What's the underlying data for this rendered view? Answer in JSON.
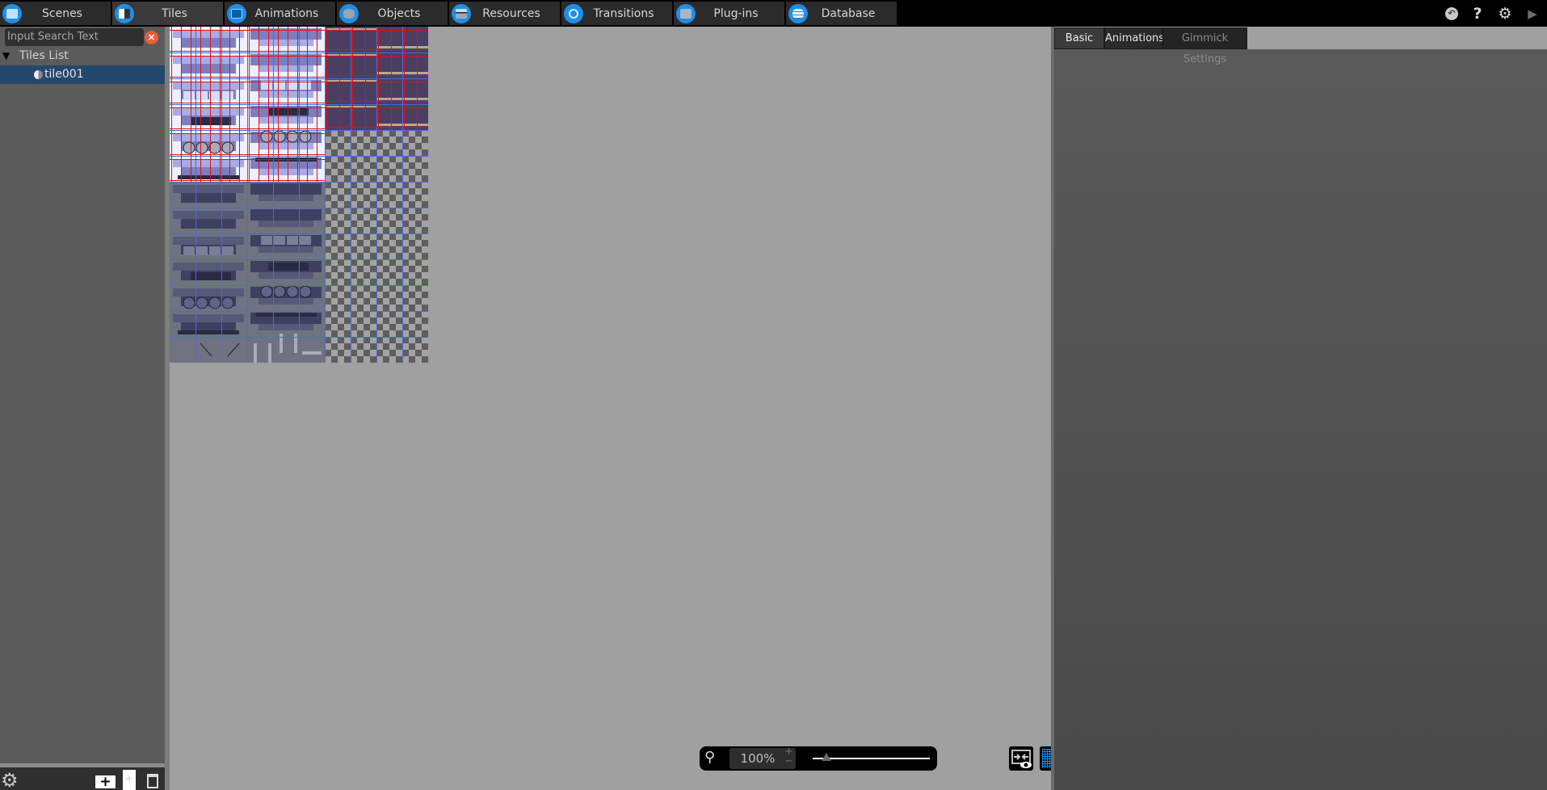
{
  "topnav": {
    "tabs": [
      {
        "label": "Scenes",
        "icon": "scenes-icon",
        "active": false
      },
      {
        "label": "Tiles",
        "icon": "tiles-icon",
        "active": true
      },
      {
        "label": "Animations",
        "icon": "animations-icon",
        "active": false
      },
      {
        "label": "Objects",
        "icon": "objects-icon",
        "active": false
      },
      {
        "label": "Resources",
        "icon": "resources-icon",
        "active": false
      },
      {
        "label": "Transitions",
        "icon": "transitions-icon",
        "active": false
      },
      {
        "label": "Plug-ins",
        "icon": "plugins-icon",
        "active": false
      },
      {
        "label": "Database",
        "icon": "database-icon",
        "active": false
      }
    ],
    "right_icons": {
      "undo": "↶",
      "help": "?",
      "settings": "⚙",
      "play": "▶"
    }
  },
  "left_panel": {
    "search": {
      "placeholder": "Input Search Text",
      "value": "",
      "clear": "×"
    },
    "tree": {
      "root_label": "Tiles List",
      "expanded_glyph": "▼",
      "items": [
        {
          "label": "tile001",
          "selected": true
        }
      ]
    },
    "toolbar": {
      "settings": "⚙",
      "add_folder": "+",
      "add_file": "+",
      "delete": ""
    }
  },
  "canvas": {
    "tileset": "tile001",
    "zoom": {
      "search_glyph": "🔍",
      "value": "100%",
      "plus": "+",
      "minus": "−",
      "slider_fraction": 0.12
    }
  },
  "right_panel": {
    "tabs": [
      {
        "label": "Basic",
        "active": true
      },
      {
        "label": "Animations",
        "active": false
      },
      {
        "label": "Gimmick Settings",
        "active": false,
        "disabled": true
      }
    ]
  },
  "colors": {
    "accent": "#1f8ee6",
    "selection": "#24476d",
    "clear_button": "#ee5a3b",
    "grid_line": "#e01010"
  }
}
